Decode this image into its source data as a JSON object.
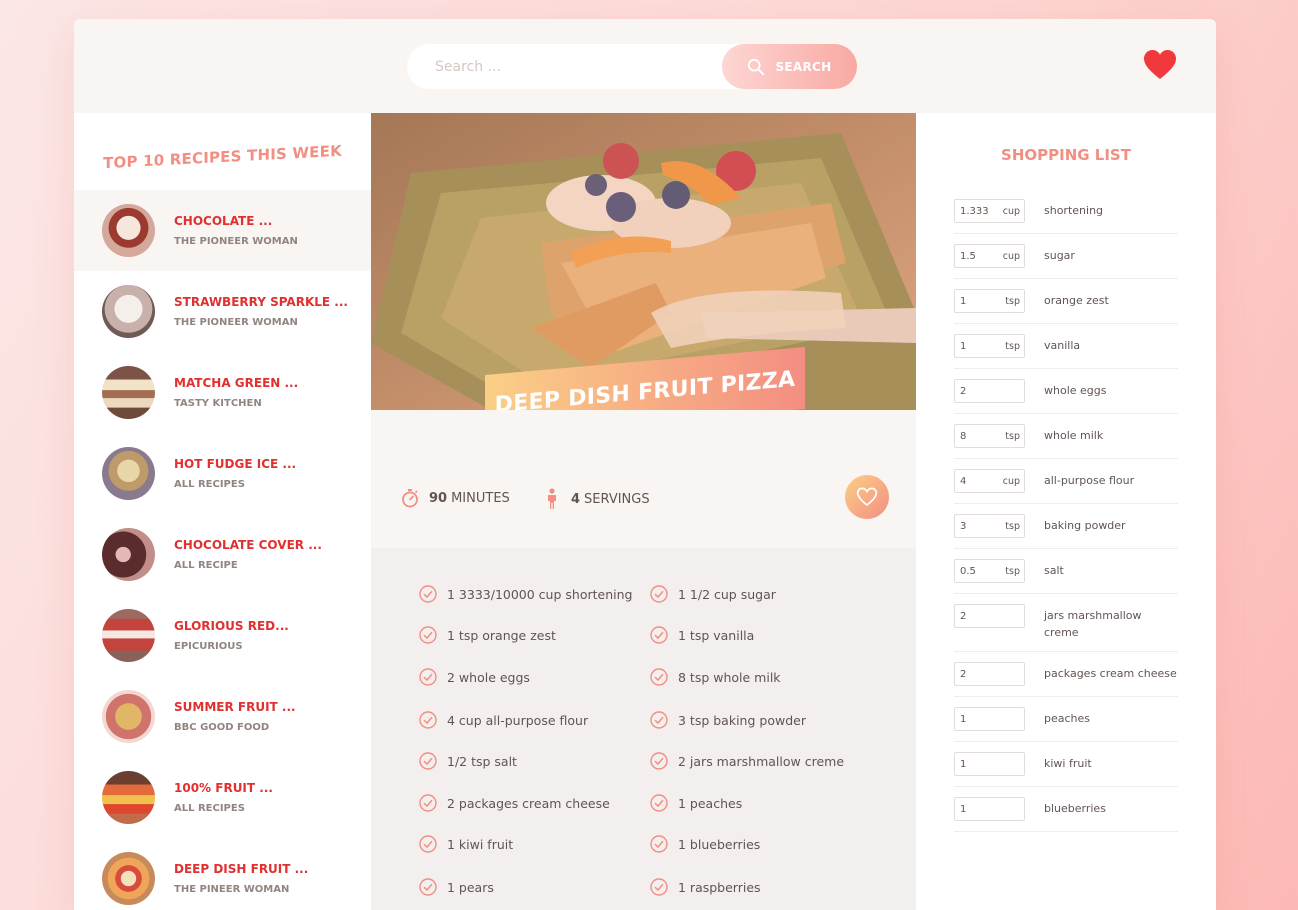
{
  "header": {
    "search_placeholder": "Search ...",
    "search_button": "SEARCH",
    "bookmarks_icon": "heart-icon"
  },
  "results": {
    "title": "TOP 10 RECIPES THIS WEEK",
    "items": [
      {
        "name": "CHOCOLATE ...",
        "author": "THE PIONEER WOMAN",
        "active": true
      },
      {
        "name": "STRAWBERRY SPARKLE ...",
        "author": "THE PIONEER WOMAN"
      },
      {
        "name": "MATCHA GREEN ...",
        "author": "TASTY KITCHEN"
      },
      {
        "name": "HOT FUDGE ICE ...",
        "author": "ALL RECIPES"
      },
      {
        "name": "CHOCOLATE COVER ...",
        "author": "ALL RECIPE"
      },
      {
        "name": "GLORIOUS RED...",
        "author": "EPICURIOUS"
      },
      {
        "name": "SUMMER FRUIT ...",
        "author": "BBC GOOD FOOD"
      },
      {
        "name": "100% FRUIT ...",
        "author": "ALL RECIPES"
      },
      {
        "name": "DEEP DISH FRUIT ...",
        "author": "THE PINEER WOMAN"
      }
    ]
  },
  "recipe": {
    "title": "DEEP DISH FRUIT PIZZA",
    "minutes": "90",
    "minutes_label": "MINUTES",
    "servings": "4",
    "servings_label": "SERVINGS",
    "ingredients": [
      [
        "1 3333/10000 cup shortening",
        "1 1/2 cup sugar"
      ],
      [
        "1 tsp orange zest",
        "1 tsp vanilla"
      ],
      [
        "2 whole eggs",
        "8 tsp whole milk"
      ],
      [
        "4 cup all-purpose flour",
        "3 tsp baking powder"
      ],
      [
        "1/2 tsp salt",
        "2 jars marshmallow creme"
      ],
      [
        "2 packages cream cheese",
        "1 peaches"
      ],
      [
        "1 kiwi fruit",
        "1 blueberries"
      ],
      [
        "1 pears",
        "1 raspberries"
      ]
    ]
  },
  "shopping": {
    "title": "SHOPPING LIST",
    "items": [
      {
        "qty": "1.3333",
        "unit": "cup",
        "name": "shortening"
      },
      {
        "qty": "1.5",
        "unit": "cup",
        "name": "sugar"
      },
      {
        "qty": "1",
        "unit": "tsp",
        "name": "orange zest"
      },
      {
        "qty": "1",
        "unit": "tsp",
        "name": "vanilla"
      },
      {
        "qty": "2",
        "unit": "",
        "name": "whole eggs"
      },
      {
        "qty": "8",
        "unit": "tsp",
        "name": "whole milk"
      },
      {
        "qty": "4",
        "unit": "cup",
        "name": "all-purpose flour"
      },
      {
        "qty": "3",
        "unit": "tsp",
        "name": "baking powder"
      },
      {
        "qty": "0.5",
        "unit": "tsp",
        "name": "salt"
      },
      {
        "qty": "2",
        "unit": "",
        "name": "jars marshmallow creme"
      },
      {
        "qty": "2",
        "unit": "",
        "name": "packages cream cheese"
      },
      {
        "qty": "1",
        "unit": "",
        "name": "peaches"
      },
      {
        "qty": "1",
        "unit": "",
        "name": "kiwi fruit"
      },
      {
        "qty": "1",
        "unit": "",
        "name": "blueberries"
      }
    ]
  },
  "colors": {
    "accent": "#f38e82",
    "accent_light": "#fbcf86",
    "link_red": "#e03030",
    "bg_light": "#f9f5f3"
  }
}
